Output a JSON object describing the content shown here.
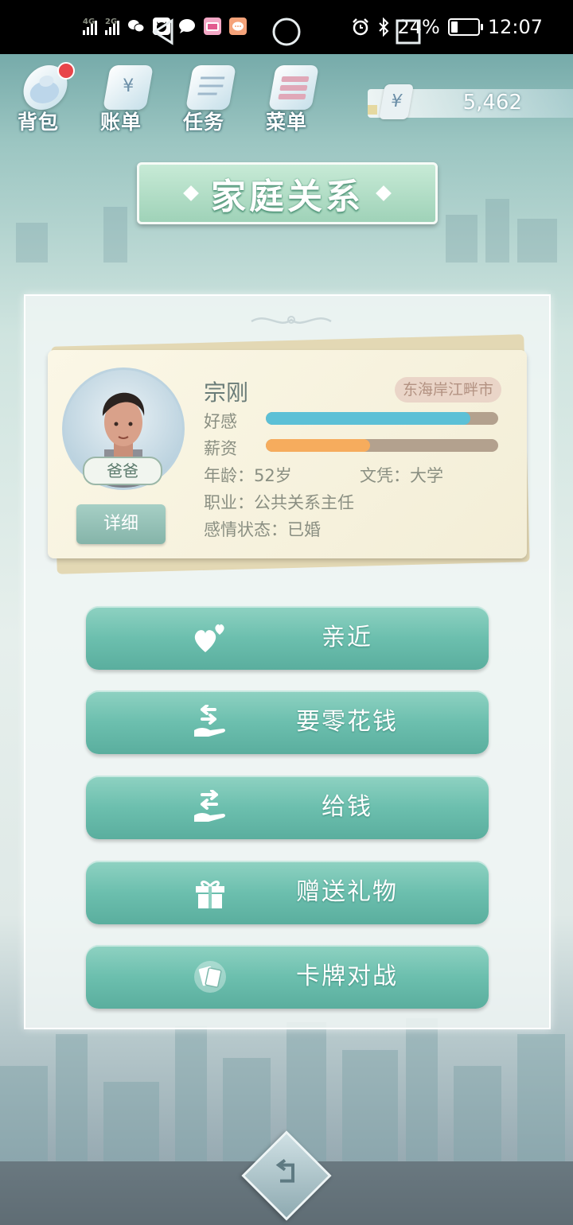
{
  "status_bar": {
    "net1": "4G",
    "net2": "2G",
    "battery": "24%",
    "time": "12:07"
  },
  "top_menu": [
    {
      "label": "背包"
    },
    {
      "label": "账单"
    },
    {
      "label": "任务"
    },
    {
      "label": "菜单"
    }
  ],
  "currency": {
    "symbol": "¥",
    "amount": "5,462"
  },
  "title": "家庭关系",
  "profile": {
    "name": "宗刚",
    "location": "东海岸江畔市",
    "relation": "爸爸",
    "affection_label": "好感",
    "affection_level": 0.88,
    "salary_label": "薪资",
    "salary_level": 0.45,
    "age": "年龄：52岁",
    "education": "文凭：大学",
    "occupation": "职业：公共关系主任",
    "relationship_status": "感情状态：已婚",
    "detail_button": "详细"
  },
  "actions": [
    {
      "label": "亲近",
      "icon": "hearts-icon"
    },
    {
      "label": "要零花钱",
      "icon": "hand-receive-icon"
    },
    {
      "label": "给钱",
      "icon": "hand-give-icon"
    },
    {
      "label": "赠送礼物",
      "icon": "gift-icon"
    },
    {
      "label": "卡牌对战",
      "icon": "cards-icon"
    }
  ],
  "colors": {
    "affection_bar": "#5cc0d6",
    "salary_bar": "#f6ac5d",
    "button_teal": "#6cbfae"
  }
}
